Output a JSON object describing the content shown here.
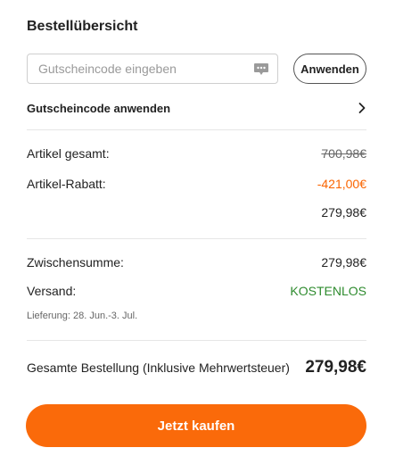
{
  "header": {
    "title": "Bestellübersicht"
  },
  "coupon": {
    "placeholder": "Gutscheincode eingeben",
    "value": "",
    "apply_label": "Anwenden",
    "link_label": "Gutscheincode anwenden"
  },
  "summary": {
    "items_total_label": "Artikel gesamt:",
    "items_total_value": "700,98€",
    "discount_label": "Artikel-Rabatt:",
    "discount_value": "-421,00€",
    "after_discount_value": "279,98€",
    "subtotal_label": "Zwischensumme:",
    "subtotal_value": "279,98€",
    "shipping_label": "Versand:",
    "shipping_value": "KOSTENLOS",
    "delivery_text": "Lieferung: 28. Jun.-3. Jul.",
    "order_total_label": "Gesamte Bestellung (Inklusive Mehrwertsteuer)",
    "order_total_value": "279,98€"
  },
  "checkout": {
    "buy_label": "Jetzt kaufen"
  },
  "colors": {
    "accent": "#fa6a0a",
    "discount": "#fa6400",
    "free_shipping": "#2e8b2e"
  },
  "icons": {
    "coupon_field": "chat-bubble-icon",
    "coupon_link": "chevron-right-icon"
  }
}
